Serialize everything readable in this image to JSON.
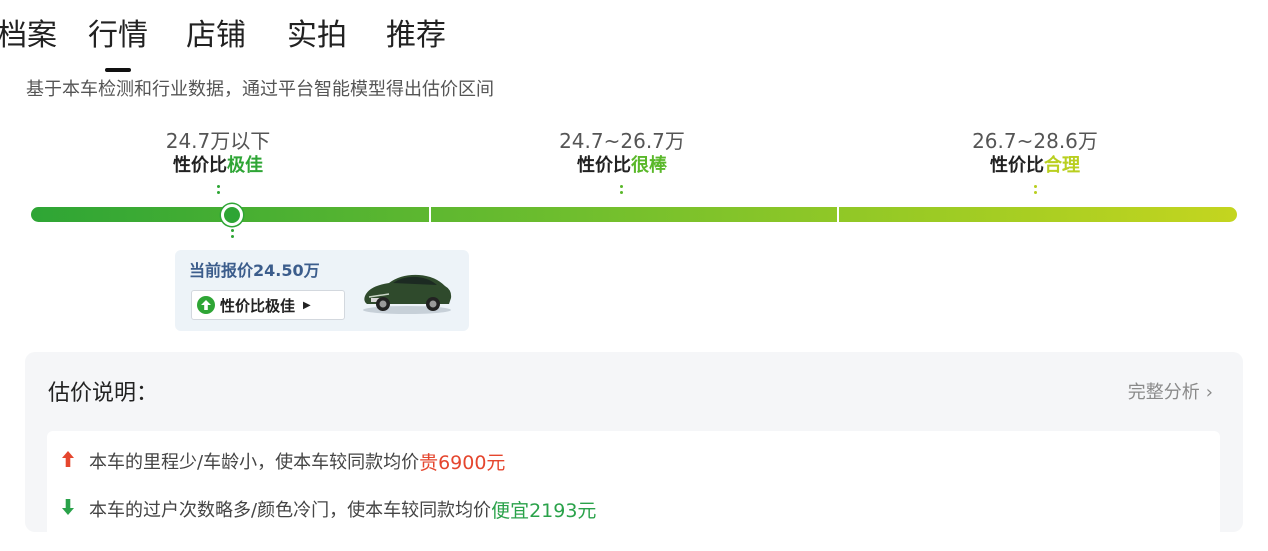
{
  "tabs": [
    "档案",
    "行情",
    "店铺",
    "实拍",
    "推荐"
  ],
  "subtitle": "基于本车检测和行业数据，通过平台智能模型得出估价区间",
  "price_segments": [
    {
      "range": "24.7万以下",
      "rating_prefix": "性价比",
      "rating_value": "极佳",
      "color": "#2ea535"
    },
    {
      "range": "24.7~26.7万",
      "rating_prefix": "性价比",
      "rating_value": "很棒",
      "color": "#5ab82a"
    },
    {
      "range": "26.7~28.6万",
      "rating_prefix": "性价比",
      "rating_value": "合理",
      "color": "#b9cf1f"
    }
  ],
  "current_price": {
    "label": "当前报价24.50万",
    "badge": "性价比极佳",
    "level": "极佳"
  },
  "explanation": {
    "title": "估价说明：",
    "full_link": "完整分析",
    "items": [
      {
        "direction": "up",
        "text": "本车的里程少/车龄小，使本车较同款均价",
        "highlight": "贵6900元",
        "color": "#e5462e"
      },
      {
        "direction": "down",
        "text": "本车的过户次数略多/颜色冷门，使本车较同款均价",
        "highlight": "便宜2193元",
        "color": "#2aa24a"
      }
    ]
  },
  "colors": {
    "bar_start": "#2ea535",
    "bar_end": "#c4d51f",
    "price_text": "#3c5d8c",
    "up": "#e5462e",
    "down": "#2aa24a"
  }
}
